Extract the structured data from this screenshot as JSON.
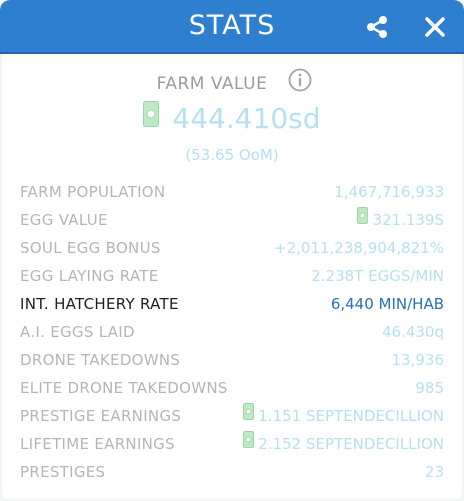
{
  "header": {
    "title": "STATS"
  },
  "farm_value": {
    "label": "FARM VALUE",
    "value": "444.410sd",
    "sub": "(53.65 OoM)"
  },
  "stats": [
    {
      "label": "FARM POPULATION",
      "value": "1,467,716,933",
      "cash": false,
      "highlight": false
    },
    {
      "label": "EGG VALUE",
      "value": "321.139S",
      "cash": true,
      "highlight": false
    },
    {
      "label": "SOUL EGG BONUS",
      "value": "+2,011,238,904,821%",
      "cash": false,
      "highlight": false
    },
    {
      "label": "EGG LAYING RATE",
      "value": "2.238T EGGS/MIN",
      "cash": false,
      "highlight": false
    },
    {
      "label": "INT. HATCHERY RATE",
      "value": "6,440 MIN/HAB",
      "cash": false,
      "highlight": true
    },
    {
      "label": "A.I. EGGS LAID",
      "value": "46.430q",
      "cash": false,
      "highlight": false
    },
    {
      "label": "DRONE TAKEDOWNS",
      "value": "13,936",
      "cash": false,
      "highlight": false
    },
    {
      "label": "ELITE DRONE TAKEDOWNS",
      "value": "985",
      "cash": false,
      "highlight": false
    },
    {
      "label": "PRESTIGE EARNINGS",
      "value": "1.151 SEPTENDECILLION",
      "cash": true,
      "highlight": false
    },
    {
      "label": "LIFETIME EARNINGS",
      "value": "2.152 SEPTENDECILLION",
      "cash": true,
      "highlight": false
    },
    {
      "label": "PRESTIGES",
      "value": "23",
      "cash": false,
      "highlight": false
    }
  ],
  "colors": {
    "header": "#2f7fd1",
    "value_light": "#b7dff0",
    "highlight_value": "#2b6fb8",
    "cash_icon": "#b9e6c0"
  },
  "icons": {
    "share": "share-icon",
    "close": "close-icon",
    "info": "info-icon",
    "cash": "cash-icon"
  }
}
